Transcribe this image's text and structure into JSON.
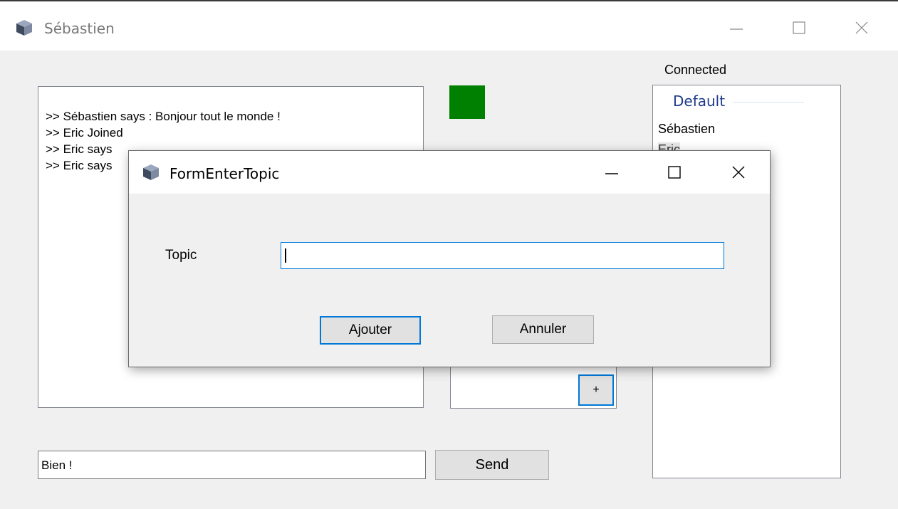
{
  "window": {
    "title": "Sébastien",
    "icon": "cube-icon",
    "controls": [
      "minimize-icon",
      "maximize-icon",
      "close-icon"
    ]
  },
  "chat": {
    "lines": [
      ">> Sébastien says : Bonjour tout le monde !",
      ">> Eric Joined",
      ">> Eric says",
      ">> Eric says"
    ]
  },
  "status": {
    "color": "#008000"
  },
  "topics": {
    "add_label": "+"
  },
  "users": {
    "header": "Connected",
    "group": "Default",
    "items": [
      "Sébastien",
      "Eric"
    ]
  },
  "message": {
    "value": "Bien !"
  },
  "send": {
    "label": "Send"
  },
  "dialog": {
    "title": "FormEnterTopic",
    "topic_label": "Topic",
    "topic_value": "",
    "add_label": "Ajouter",
    "cancel_label": "Annuler"
  }
}
